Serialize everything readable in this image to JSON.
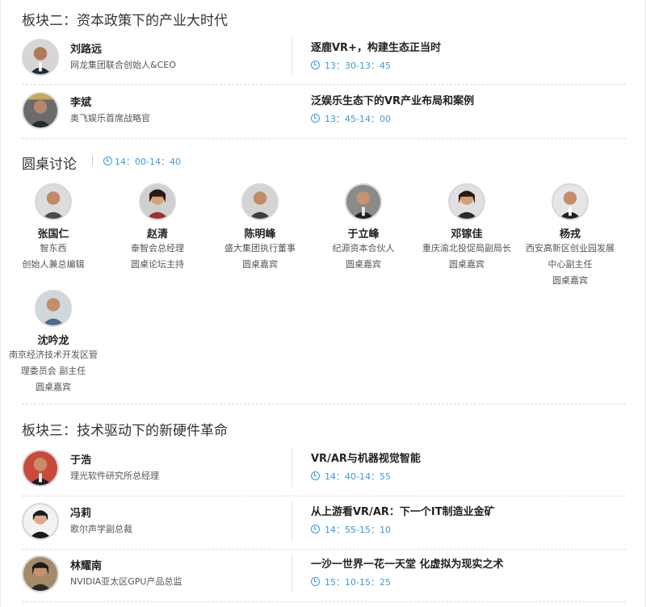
{
  "block2": {
    "title": "板块二：资本政策下的产业大时代",
    "talks": [
      {
        "name": "刘路远",
        "role": "网龙集团联合创始人&CEO",
        "title": "逐鹿VR+，构建生态正当时",
        "time": "13：30-13：45"
      },
      {
        "name": "李斌",
        "role": "奥飞娱乐首席战略官",
        "title": "泛娱乐生态下的VR产业布局和案例",
        "time": "13：45-14：00"
      }
    ]
  },
  "roundtable": {
    "title": "圆桌讨论",
    "time": "14：00-14：40",
    "panelists": [
      {
        "name": "张国仁",
        "lines": [
          "智东西",
          "创始人兼总编辑"
        ]
      },
      {
        "name": "赵清",
        "lines": [
          "泰智会总经理",
          "圆桌论坛主持"
        ]
      },
      {
        "name": "陈明峰",
        "lines": [
          "盛大集团执行董事",
          "圆桌嘉宾"
        ]
      },
      {
        "name": "于立峰",
        "lines": [
          "纪源资本合伙人",
          "圆桌嘉宾"
        ]
      },
      {
        "name": "邓镓佳",
        "lines": [
          "重庆渝北投促局副局长",
          "圆桌嘉宾"
        ]
      },
      {
        "name": "杨戎",
        "lines": [
          "西安高新区创业园发展",
          "中心副主任",
          "圆桌嘉宾"
        ]
      },
      {
        "name": "沈吟龙",
        "lines": [
          "南京经济技术开发区管",
          "理委员会 副主任",
          "圆桌嘉宾"
        ]
      }
    ]
  },
  "block3": {
    "title": "板块三：技术驱动下的新硬件革命",
    "talks": [
      {
        "name": "于浩",
        "role": "理光软件研究所总经理",
        "title": "VR/AR与机器视觉智能",
        "time": "14：40-14：55"
      },
      {
        "name": "冯莉",
        "role": "歌尔声学副总裁",
        "title": "从上游看VR/AR：下一个IT制造业金矿",
        "time": "14：55-15：10"
      },
      {
        "name": "林耀南",
        "role": "NVIDIA亚太区GPU产品总监",
        "title": "一沙一世界一花一天堂 化虚拟为现实之术",
        "time": "15：10-15：25"
      }
    ]
  },
  "colors": {
    "accent": "#3a9ad9",
    "text": "#222222",
    "divider": "#dcdcdc"
  },
  "icons": {
    "time": "clock-icon",
    "speaker": "avatar"
  }
}
